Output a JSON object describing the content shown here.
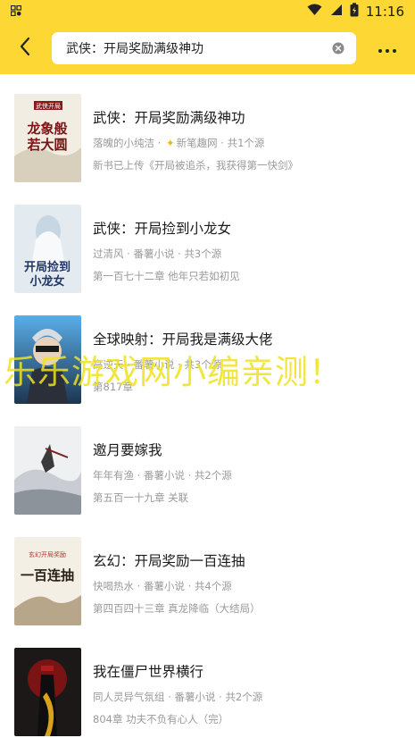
{
  "status": {
    "time": "11:16"
  },
  "header": {
    "search_value": "武侠：开局奖励满级神功"
  },
  "books": [
    {
      "title": "武侠：开局奖励满级神功",
      "author": "落魄的小纯洁",
      "source": "新笔趣网",
      "source_count": "共1个源",
      "latest": "新书已上传《开局被追杀，我获得第一快剑》",
      "cover_text": "龙象般若大圆满",
      "cover_colors": [
        "#f4efe4",
        "#8a1a1a"
      ]
    },
    {
      "title": "武侠：开局捡到小龙女",
      "author": "过清风",
      "source": "番薯小说",
      "source_count": "共3个源",
      "latest": "第一百七十二章 他年只若如初见",
      "cover_text": "开局捡到小龙女",
      "cover_colors": [
        "#dfe8f0",
        "#2a3b63"
      ]
    },
    {
      "title": "全球映射：开局我是满级大佬",
      "author": "高逆天",
      "source": "番薯小说",
      "source_count": "共3个源",
      "latest": "第817章",
      "cover_text": "",
      "cover_colors": [
        "#4a9bd6",
        "#1d3550"
      ]
    },
    {
      "title": "邀月要嫁我",
      "author": "年年有渔",
      "source": "番薯小说",
      "source_count": "共2个源",
      "latest": "第五百一十九章 关联",
      "cover_text": "",
      "cover_colors": [
        "#eef0f2",
        "#6a6f78"
      ]
    },
    {
      "title": "玄幻：开局奖励一百连抽",
      "author": "快喝热水",
      "source": "番薯小说",
      "source_count": "共4个源",
      "latest": "第四百四十三章 真龙降临（大结局）",
      "cover_text": "一百连抽",
      "cover_colors": [
        "#f4f0e6",
        "#6b4a2a"
      ]
    },
    {
      "title": "我在僵尸世界横行",
      "author": "同人灵异气氛组",
      "source": "番薯小说",
      "source_count": "共2个源",
      "latest": "804章 功夫不负有心人（完）",
      "cover_text": "",
      "cover_colors": [
        "#1e1a1a",
        "#c21f1f"
      ]
    }
  ],
  "watermark": "乐乐游戏网小编亲测！"
}
